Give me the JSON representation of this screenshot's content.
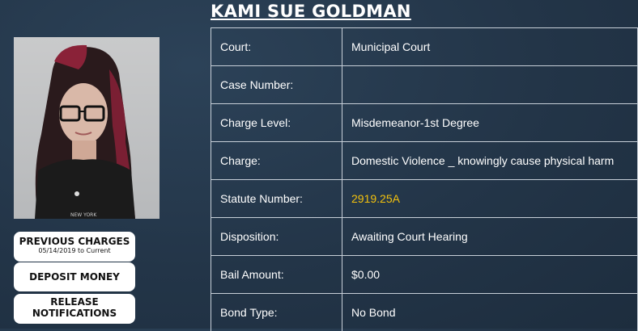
{
  "person": {
    "name": "KAMI SUE GOLDMAN"
  },
  "photo": {
    "shirt_text": "NEW YORK"
  },
  "buttons": {
    "previous_charges": "PREVIOUS CHARGES",
    "previous_charges_range": "05/14/2019 to Current",
    "deposit_money": "DEPOSIT MONEY",
    "release_notifications_line1": "RELEASE",
    "release_notifications_line2": "NOTIFICATIONS"
  },
  "charge": {
    "court_label": "Court:",
    "court": "Municipal Court",
    "case_number_label": "Case Number:",
    "case_number": "",
    "charge_level_label": "Charge Level:",
    "charge_level": "Misdemeanor-1st Degree",
    "charge_label": "Charge:",
    "charge": "Domestic Violence _ knowingly cause physical harm",
    "statute_number_label": "Statute Number:",
    "statute_number": "2919.25A",
    "disposition_label": "Disposition:",
    "disposition": "Awaiting Court Hearing",
    "bail_amount_label": "Bail Amount:",
    "bail_amount": "$0.00",
    "bond_type_label": "Bond Type:",
    "bond_type": "No Bond"
  },
  "colors": {
    "link": "#f4c20d",
    "background": "#243648"
  }
}
